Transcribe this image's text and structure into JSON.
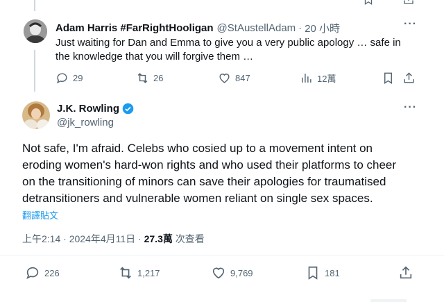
{
  "reply": {
    "display_name": "Adam Harris #FarRightHooligan",
    "handle": "@StAustellAdam",
    "separator": "·",
    "time": "20 小時",
    "text_line1": "Just waiting for Dan and Emma to give you a very public apology … safe in",
    "text_line2": "the knowledge that you will forgive them …",
    "replies": "29",
    "reposts": "26",
    "likes": "847",
    "views": "12萬"
  },
  "main": {
    "display_name": "J.K. Rowling",
    "handle": "@jk_rowling",
    "text_line1": "Not safe, I'm afraid. Celebs who cosied up to a movement intent on",
    "text_line2": "eroding women's hard-won rights and who used their platforms to cheer",
    "text_line3": "on the transitioning of minors can save their apologies for traumatised",
    "text_line4": "detransitioners and vulnerable women reliant on single sex spaces.",
    "translate_label": "翻譯貼文",
    "timestamp": "上午2:14 · 2024年4月11日 · ",
    "view_count": "27.3萬",
    "view_label": " 次查看",
    "replies": "226",
    "reposts": "1,217",
    "likes": "9,769",
    "bookmarks": "181"
  },
  "colors": {
    "accent": "#1d9bf0",
    "muted": "#536471",
    "text": "#0f1419"
  },
  "icons": [
    "reply-icon",
    "repost-icon",
    "like-icon",
    "views-icon",
    "bookmark-icon",
    "share-icon",
    "more-icon",
    "verified-badge-icon"
  ]
}
